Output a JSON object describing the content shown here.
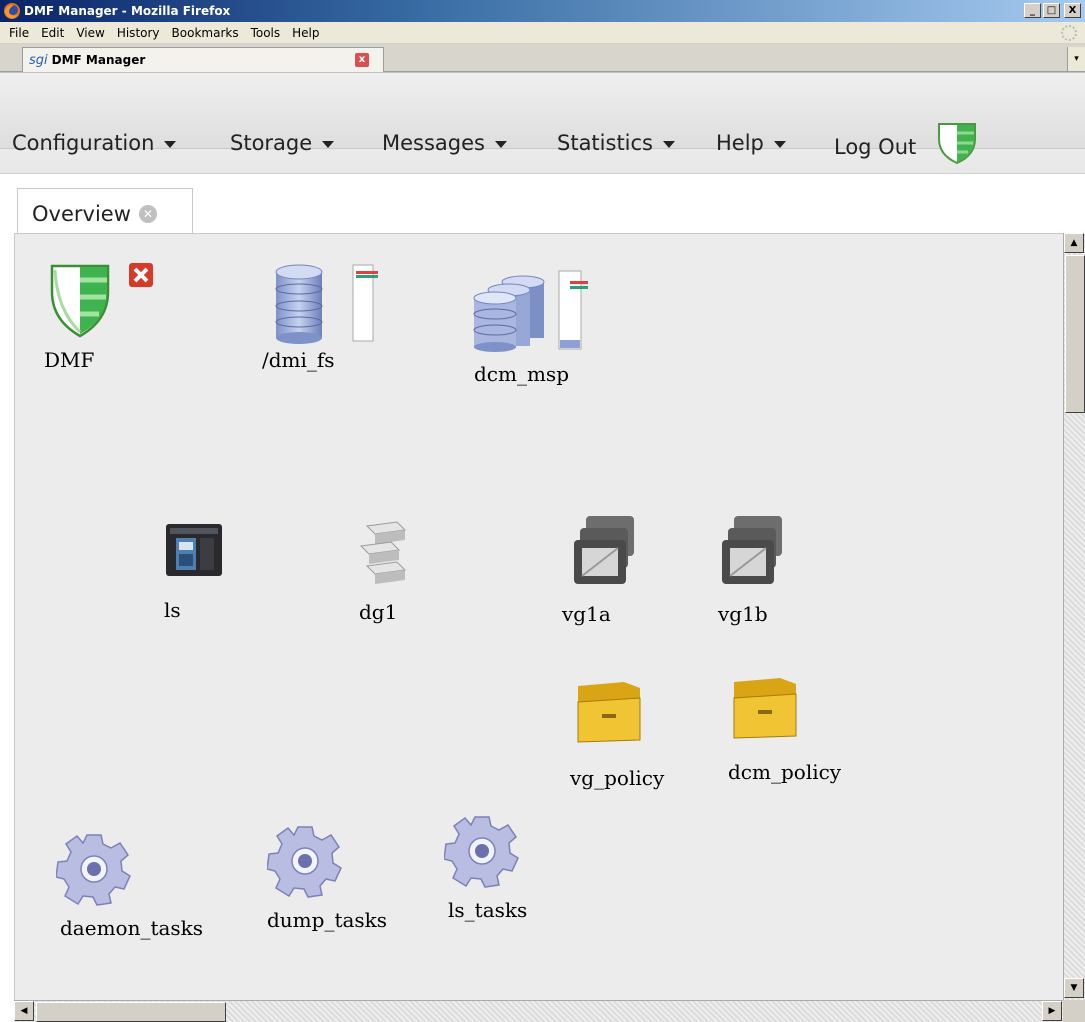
{
  "window": {
    "title": "DMF Manager - Mozilla Firefox",
    "min_label": "_",
    "max_label": "□",
    "close_label": "X"
  },
  "menubar": {
    "items": [
      "File",
      "Edit",
      "View",
      "History",
      "Bookmarks",
      "Tools",
      "Help"
    ]
  },
  "browser_tab": {
    "logo": "sgi",
    "label": "DMF Manager",
    "close_label": "x"
  },
  "app_menu": {
    "configuration": "Configuration",
    "storage": "Storage",
    "messages": "Messages",
    "statistics": "Statistics",
    "help": "Help",
    "logout": "Log Out"
  },
  "content_tab": {
    "label": "Overview"
  },
  "nodes": {
    "dmf": "DMF",
    "dmi_fs": "/dmi_fs",
    "dcm_msp": "dcm_msp",
    "ls": "ls",
    "dg1": "dg1",
    "vg1a": "vg1a",
    "vg1b": "vg1b",
    "vg_policy": "vg_policy",
    "dcm_policy": "dcm_policy",
    "daemon_tasks": "daemon_tasks",
    "dump_tasks": "dump_tasks",
    "ls_tasks": "ls_tasks"
  },
  "colors": {
    "shield_green": "#3fb34f",
    "error_red": "#d83a2a",
    "disk_blue": "#8fa3d4",
    "folder_yellow": "#e0b31a",
    "gear_lavender": "#b9bde2"
  }
}
